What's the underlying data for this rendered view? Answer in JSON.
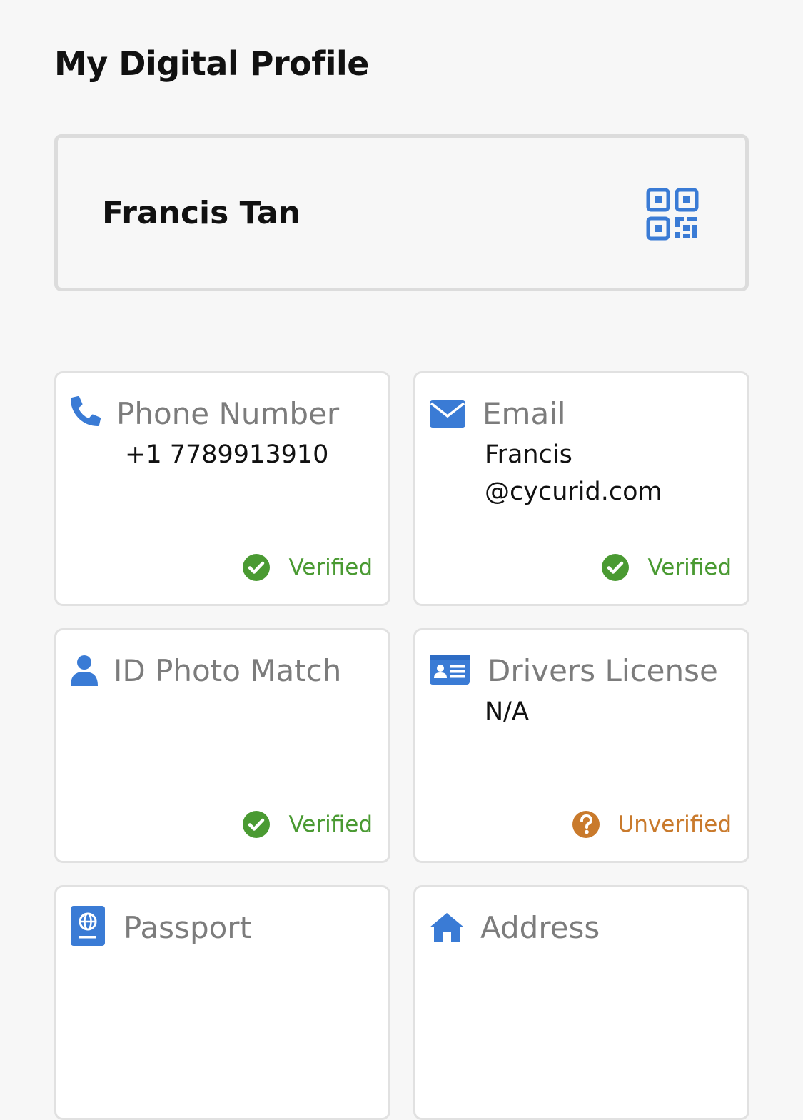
{
  "page": {
    "title": "My Digital Profile"
  },
  "profile": {
    "name": "Francis Tan",
    "qr_icon": "qr-code-icon",
    "accent_color": "#3a7bd5"
  },
  "cards": {
    "phone": {
      "label": "Phone Number",
      "value": "+1 7789913910",
      "status": "Verified",
      "icon": "phone-icon"
    },
    "email": {
      "label": "Email",
      "value_line1": "Francis",
      "value_line2": "@cycurid.com",
      "status": "Verified",
      "icon": "envelope-icon"
    },
    "id_photo": {
      "label": "ID Photo Match",
      "status": "Verified",
      "icon": "user-icon"
    },
    "drivers_license": {
      "label": "Drivers License",
      "value": "N/A",
      "status": "Unverified",
      "icon": "id-card-icon"
    },
    "passport": {
      "label": "Passport",
      "icon": "passport-icon"
    },
    "address": {
      "label": "Address",
      "icon": "home-icon"
    }
  },
  "colors": {
    "verified": "#4a9a32",
    "unverified": "#c97a2c",
    "icon_blue": "#3a7bd5"
  }
}
